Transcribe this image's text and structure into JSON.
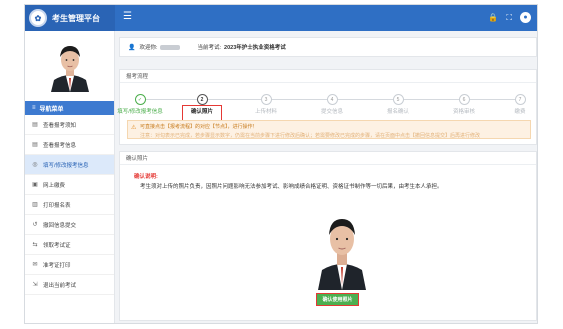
{
  "app": {
    "title": "考生管理平台",
    "logo_glyph": "✿"
  },
  "topbar": {
    "menu_icon": "hamburger-icon",
    "icons": [
      "lock-icon",
      "fullscreen-icon",
      "user-icon"
    ]
  },
  "sidebar": {
    "nav_header": "导航菜单",
    "items": [
      {
        "label": "查看报考须知",
        "icon": "document-icon",
        "active": false
      },
      {
        "label": "查看报考信息",
        "icon": "document-icon",
        "active": false
      },
      {
        "label": "填写/修改报考信息",
        "icon": "edit-icon",
        "active": true
      },
      {
        "label": "网上缴费",
        "icon": "payment-icon",
        "active": false
      },
      {
        "label": "打印报名表",
        "icon": "printer-icon",
        "active": false
      },
      {
        "label": "撤回信息提交",
        "icon": "undo-icon",
        "active": false
      },
      {
        "label": "领取考试证",
        "icon": "swap-icon",
        "active": false
      },
      {
        "label": "准考证打印",
        "icon": "ticket-icon",
        "active": false
      },
      {
        "label": "退出当前考试",
        "icon": "exit-icon",
        "active": false
      }
    ]
  },
  "welcome": {
    "greeting": "欢迎你:",
    "exam_label": "当前考试:",
    "exam_name": "2023年护士执业资格考试"
  },
  "process": {
    "title": "报考流程",
    "steps": [
      {
        "num": "✓",
        "label": "填写/修改报考信息",
        "state": "done"
      },
      {
        "num": "2",
        "label": "确认照片",
        "state": "current"
      },
      {
        "num": "3",
        "label": "上传材料",
        "state": "todo"
      },
      {
        "num": "4",
        "label": "提交信息",
        "state": "todo"
      },
      {
        "num": "5",
        "label": "报名确认",
        "state": "todo"
      },
      {
        "num": "6",
        "label": "资格审核",
        "state": "todo"
      },
      {
        "num": "7",
        "label": "缴费",
        "state": "todo"
      }
    ],
    "notice_line1": "可直接点击【报考流程】的对应【节点】，进行操作！",
    "notice_line2": "注意：对勾表示已完成，若步骤显示数字，仍需在当前步骤下进行修改后确认；若需要修改已完成的步骤，请在页面中点击【撤回信息提交】后再进行修改"
  },
  "photo_panel": {
    "title": "确认照片",
    "confirm_head": "确认说明:",
    "confirm_text": "考生须对上传的照片负责，因照片问题影响无法参加考试、影响成绩合格证明、资格证书制作等一切后果，由考生本人承担。",
    "button_label": "确认使用照片"
  }
}
